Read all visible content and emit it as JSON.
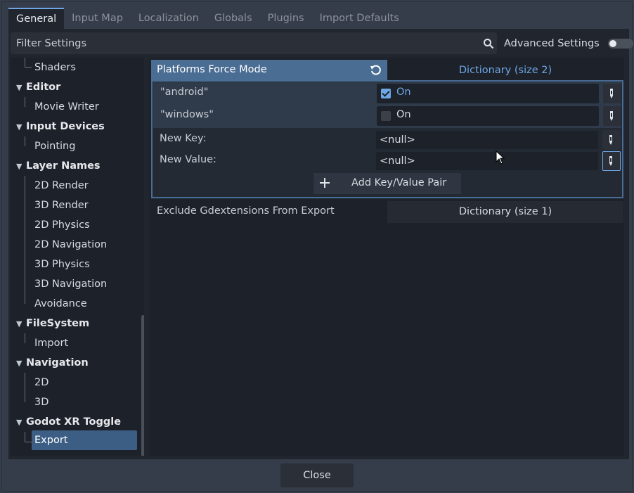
{
  "tabs": [
    "General",
    "Input Map",
    "Localization",
    "Globals",
    "Plugins",
    "Import Defaults"
  ],
  "filter": {
    "placeholder": "Filter Settings",
    "value": ""
  },
  "advanced_settings": {
    "label": "Advanced Settings",
    "enabled": false
  },
  "tree": {
    "items": [
      {
        "label": "Shaders",
        "kind": "sub"
      },
      {
        "label": "Editor",
        "kind": "category"
      },
      {
        "label": "Movie Writer",
        "kind": "sub"
      },
      {
        "label": "Input Devices",
        "kind": "category"
      },
      {
        "label": "Pointing",
        "kind": "sub"
      },
      {
        "label": "Layer Names",
        "kind": "category"
      },
      {
        "label": "2D Render",
        "kind": "sub"
      },
      {
        "label": "3D Render",
        "kind": "sub"
      },
      {
        "label": "2D Physics",
        "kind": "sub"
      },
      {
        "label": "2D Navigation",
        "kind": "sub"
      },
      {
        "label": "3D Physics",
        "kind": "sub"
      },
      {
        "label": "3D Navigation",
        "kind": "sub"
      },
      {
        "label": "Avoidance",
        "kind": "sub"
      },
      {
        "label": "FileSystem",
        "kind": "category"
      },
      {
        "label": "Import",
        "kind": "sub"
      },
      {
        "label": "Navigation",
        "kind": "category"
      },
      {
        "label": "2D",
        "kind": "sub"
      },
      {
        "label": "3D",
        "kind": "sub"
      },
      {
        "label": "Godot XR Toggle",
        "kind": "category"
      },
      {
        "label": "Export",
        "kind": "sub",
        "selected": true
      }
    ]
  },
  "inspector": {
    "prop1": {
      "label": "Platforms Force Mode",
      "value": "Dictionary (size 2)",
      "entries": [
        {
          "key": "\"android\"",
          "checked": true,
          "value_label": "On"
        },
        {
          "key": "\"windows\"",
          "checked": false,
          "value_label": "On"
        }
      ],
      "new_key_label": "New Key:",
      "new_key_value": "<null>",
      "new_value_label": "New Value:",
      "new_value_value": "<null>",
      "add_button": "Add Key/Value Pair"
    },
    "prop2": {
      "label": "Exclude Gdextensions From Export",
      "value": "Dictionary (size 1)"
    }
  },
  "footer": {
    "close_label": "Close"
  },
  "colors": {
    "accent": "#6ea7e6",
    "selection": "#3d5e84",
    "header": "#4a6d94"
  }
}
